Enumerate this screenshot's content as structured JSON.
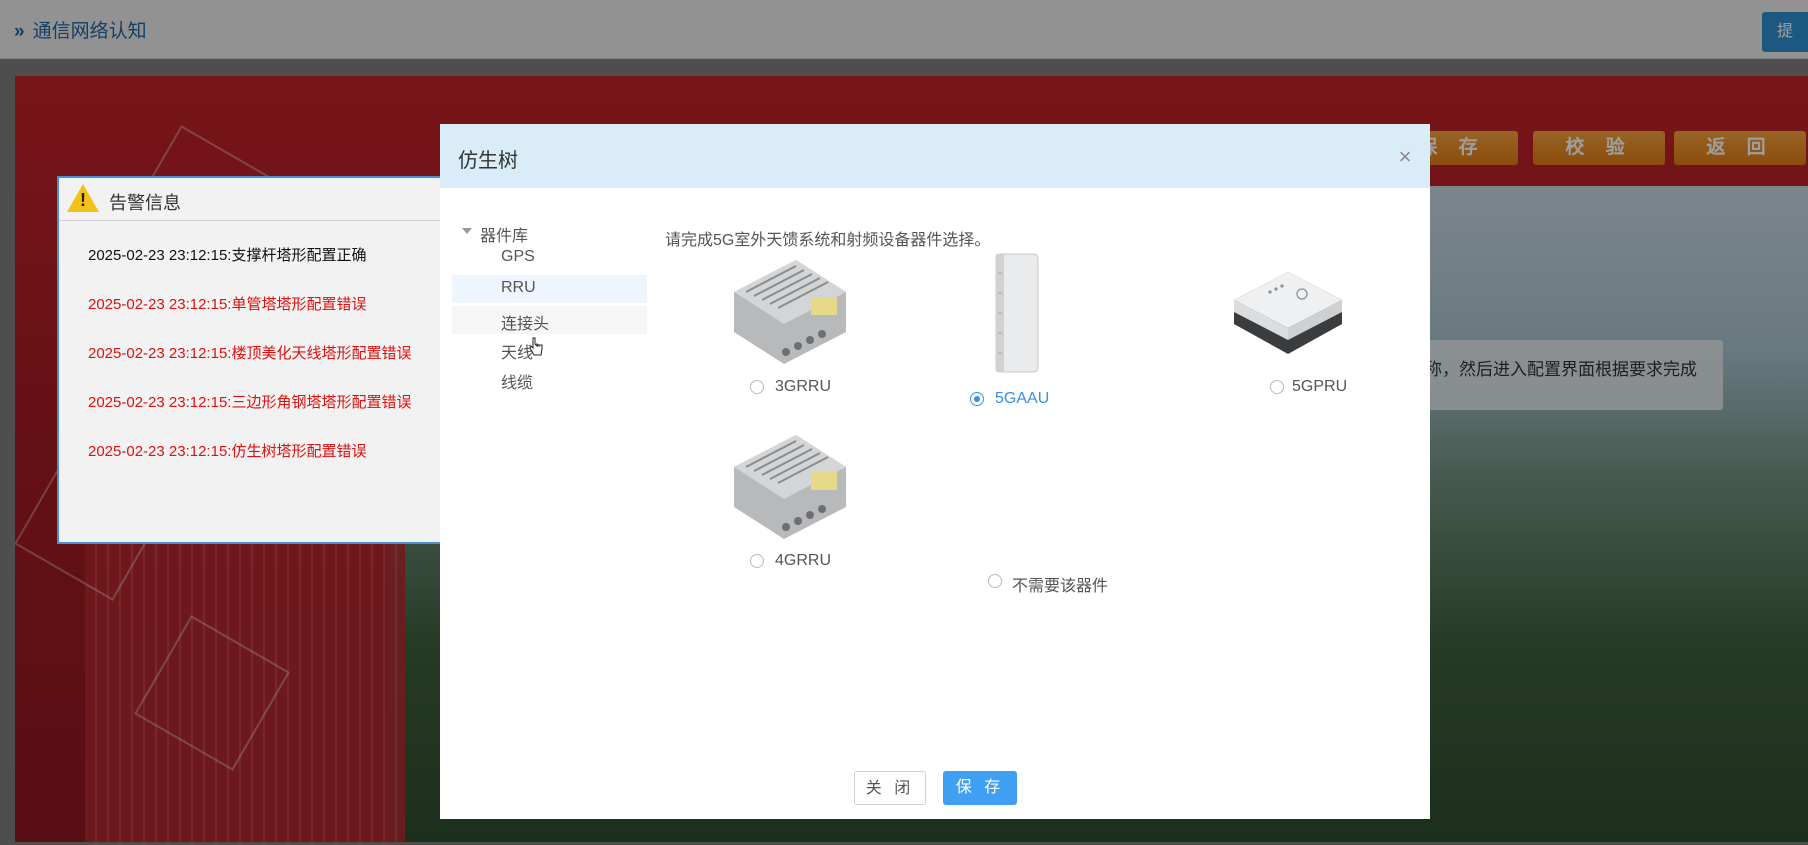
{
  "topbar": {
    "breadcrumb": "通信网络认知",
    "submit_label": "提"
  },
  "toolbar": {
    "save_label": "保 存",
    "verify_label": "校 验",
    "back_label": "返 回"
  },
  "hint": {
    "text": "称，然后进入配置界面根据要求完成"
  },
  "alarm": {
    "title": "告警信息",
    "messages": [
      {
        "text": "2025-02-23 23:12:15:支撑杆塔形配置正确",
        "color": "#111111"
      },
      {
        "text": "2025-02-23 23:12:15:单管塔塔形配置错误",
        "color": "#e01010"
      },
      {
        "text": "2025-02-23 23:12:15:楼顶美化天线塔形配置错误",
        "color": "#e01010"
      },
      {
        "text": "2025-02-23 23:12:15:三边形角钢塔塔形配置错误",
        "color": "#e01010"
      },
      {
        "text": "2025-02-23 23:12:15:仿生树塔形配置错误",
        "color": "#e01010"
      }
    ]
  },
  "dialog": {
    "title": "仿生树",
    "instruction": "请完成5G室外天馈系统和射频设备器件选择。",
    "tree": {
      "root": "器件库",
      "nodes": [
        "GPS",
        "RRU",
        "连接头",
        "天线",
        "线缆"
      ],
      "selected": "RRU",
      "hovered": "连接头"
    },
    "items": [
      {
        "name": "3GRRU",
        "selected": false,
        "icon": "rru-device-image"
      },
      {
        "name": "5GAAU",
        "selected": true,
        "icon": "aau-device-image"
      },
      {
        "name": "5GPRU",
        "selected": false,
        "icon": "pru-device-image"
      },
      {
        "name": "4GRRU",
        "selected": false,
        "icon": "rru-device-image"
      },
      {
        "name": "不需要该器件",
        "selected": false,
        "icon": "none"
      }
    ],
    "close_label": "关 闭",
    "save_label": "保 存"
  },
  "colors": {
    "accent": "#3a8ee6",
    "header_bg": "#d9ecf8",
    "error_text": "#e01010",
    "action_orange": "#f39a2e"
  }
}
